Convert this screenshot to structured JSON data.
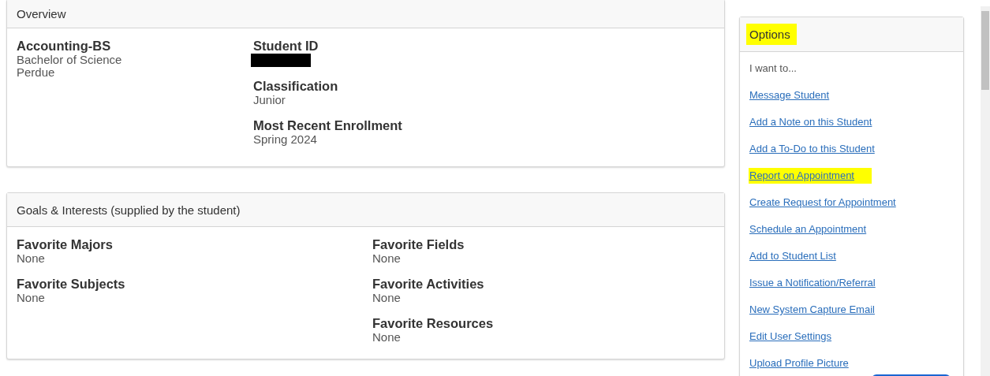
{
  "overview": {
    "title": "Overview",
    "program": {
      "name": "Accounting-BS",
      "lines": [
        "Bachelor of Science",
        "Perdue"
      ]
    },
    "fields": [
      {
        "label": "Student ID",
        "redacted": true
      },
      {
        "label": "Classification",
        "value": "Junior",
        "redacted": false
      },
      {
        "label": "Most Recent Enrollment",
        "value": "Spring 2024",
        "redacted": false
      }
    ]
  },
  "goals": {
    "title": "Goals & Interests (supplied by the student)",
    "columns": [
      [
        {
          "label": "Favorite Majors",
          "value": "None"
        },
        {
          "label": "Favorite Subjects",
          "value": "None"
        }
      ],
      [
        {
          "label": "Favorite Fields",
          "value": "None"
        },
        {
          "label": "Favorite Activities",
          "value": "None"
        },
        {
          "label": "Favorite Resources",
          "value": "None"
        }
      ]
    ]
  },
  "options": {
    "title": "Options",
    "highlighted": true,
    "intro": "I want to...",
    "links": [
      {
        "label": "Message Student",
        "highlighted": false
      },
      {
        "label": "Add a Note on this Student",
        "highlighted": false
      },
      {
        "label": "Add a To-Do to this Student",
        "highlighted": false
      },
      {
        "label": "Report on Appointment",
        "highlighted": true
      },
      {
        "label": "Create Request for Appointment",
        "highlighted": false
      },
      {
        "label": "Schedule an Appointment",
        "highlighted": false
      },
      {
        "label": "Add to Student List",
        "highlighted": false
      },
      {
        "label": "Issue a Notification/Referral",
        "highlighted": false
      },
      {
        "label": "New System Capture Email",
        "highlighted": false
      },
      {
        "label": "Edit User Settings",
        "highlighted": false
      },
      {
        "label": "Upload Profile Picture",
        "highlighted": false
      }
    ]
  }
}
